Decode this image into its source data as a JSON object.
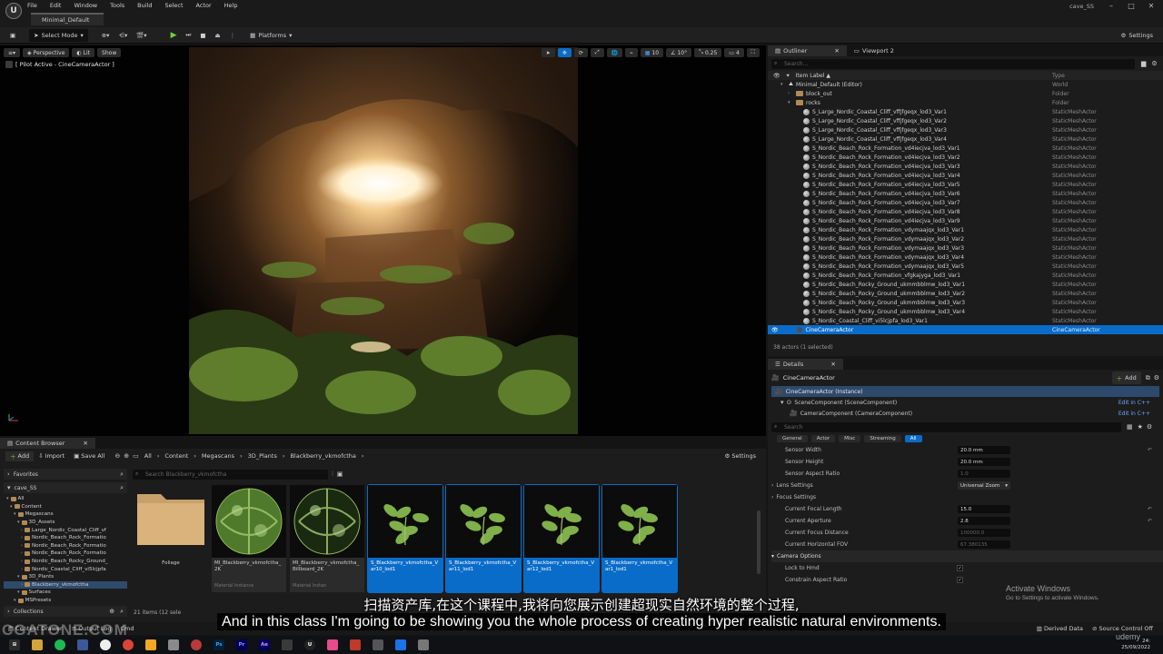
{
  "menu": [
    "File",
    "Edit",
    "Window",
    "Tools",
    "Build",
    "Select",
    "Actor",
    "Help"
  ],
  "doc_tab": "Minimal_Default",
  "window_title": "cave_SS",
  "toolbar": {
    "select_mode": "Select Mode",
    "platforms": "Platforms",
    "settings": "Settings"
  },
  "viewport": {
    "perspective": "Perspective",
    "lit": "Lit",
    "show": "Show",
    "pilot": "[ Pilot Active - CineCameraActor ]",
    "grid": "10",
    "angle": "10°",
    "scale": "0.25",
    "camera_speed": "4"
  },
  "outliner": {
    "tab": "Outliner",
    "tab2": "Viewport 2",
    "search_placeholder": "Search...",
    "col_label": "Item Label ▲",
    "col_type": "Type",
    "rows": [
      {
        "label": "Minimal_Default (Editor)",
        "type": "World",
        "indent": 1,
        "icon": "world"
      },
      {
        "label": "block_out",
        "type": "Folder",
        "indent": 2,
        "icon": "folder"
      },
      {
        "label": "rocks",
        "type": "Folder",
        "indent": 2,
        "icon": "folder"
      },
      {
        "label": "S_Large_Nordic_Coastal_Cliff_vffjfgeqx_lod3_Var1",
        "type": "StaticMeshActor",
        "indent": 3,
        "icon": "mesh"
      },
      {
        "label": "S_Large_Nordic_Coastal_Cliff_vffjfgeqx_lod3_Var2",
        "type": "StaticMeshActor",
        "indent": 3,
        "icon": "mesh"
      },
      {
        "label": "S_Large_Nordic_Coastal_Cliff_vffjfgeqx_lod3_Var3",
        "type": "StaticMeshActor",
        "indent": 3,
        "icon": "mesh"
      },
      {
        "label": "S_Large_Nordic_Coastal_Cliff_vffjfgeqx_lod3_Var4",
        "type": "StaticMeshActor",
        "indent": 3,
        "icon": "mesh"
      },
      {
        "label": "S_Nordic_Beach_Rock_Formation_vd4iecjva_lod3_Var1",
        "type": "StaticMeshActor",
        "indent": 3,
        "icon": "mesh"
      },
      {
        "label": "S_Nordic_Beach_Rock_Formation_vd4iecjva_lod3_Var2",
        "type": "StaticMeshActor",
        "indent": 3,
        "icon": "mesh"
      },
      {
        "label": "S_Nordic_Beach_Rock_Formation_vd4iecjva_lod3_Var3",
        "type": "StaticMeshActor",
        "indent": 3,
        "icon": "mesh"
      },
      {
        "label": "S_Nordic_Beach_Rock_Formation_vd4iecjva_lod3_Var4",
        "type": "StaticMeshActor",
        "indent": 3,
        "icon": "mesh"
      },
      {
        "label": "S_Nordic_Beach_Rock_Formation_vd4iecjva_lod3_Var5",
        "type": "StaticMeshActor",
        "indent": 3,
        "icon": "mesh"
      },
      {
        "label": "S_Nordic_Beach_Rock_Formation_vd4iecjva_lod3_Var6",
        "type": "StaticMeshActor",
        "indent": 3,
        "icon": "mesh"
      },
      {
        "label": "S_Nordic_Beach_Rock_Formation_vd4iecjva_lod3_Var7",
        "type": "StaticMeshActor",
        "indent": 3,
        "icon": "mesh"
      },
      {
        "label": "S_Nordic_Beach_Rock_Formation_vd4iecjva_lod3_Var8",
        "type": "StaticMeshActor",
        "indent": 3,
        "icon": "mesh"
      },
      {
        "label": "S_Nordic_Beach_Rock_Formation_vd4iecjva_lod3_Var9",
        "type": "StaticMeshActor",
        "indent": 3,
        "icon": "mesh"
      },
      {
        "label": "S_Nordic_Beach_Rock_Formation_vdymaajqx_lod3_Var1",
        "type": "StaticMeshActor",
        "indent": 3,
        "icon": "mesh"
      },
      {
        "label": "S_Nordic_Beach_Rock_Formation_vdymaajqx_lod3_Var2",
        "type": "StaticMeshActor",
        "indent": 3,
        "icon": "mesh"
      },
      {
        "label": "S_Nordic_Beach_Rock_Formation_vdymaajqx_lod3_Var3",
        "type": "StaticMeshActor",
        "indent": 3,
        "icon": "mesh"
      },
      {
        "label": "S_Nordic_Beach_Rock_Formation_vdymaajqx_lod3_Var4",
        "type": "StaticMeshActor",
        "indent": 3,
        "icon": "mesh"
      },
      {
        "label": "S_Nordic_Beach_Rock_Formation_vdymaajqx_lod3_Var5",
        "type": "StaticMeshActor",
        "indent": 3,
        "icon": "mesh"
      },
      {
        "label": "S_Nordic_Beach_Rock_Formation_vfgkajyga_lod3_Var1",
        "type": "StaticMeshActor",
        "indent": 3,
        "icon": "mesh"
      },
      {
        "label": "S_Nordic_Beach_Rocky_Ground_ukmmbblmw_lod3_Var1",
        "type": "StaticMeshActor",
        "indent": 3,
        "icon": "mesh"
      },
      {
        "label": "S_Nordic_Beach_Rocky_Ground_ukmmbblmw_lod3_Var2",
        "type": "StaticMeshActor",
        "indent": 3,
        "icon": "mesh"
      },
      {
        "label": "S_Nordic_Beach_Rocky_Ground_ukmmbblmw_lod3_Var3",
        "type": "StaticMeshActor",
        "indent": 3,
        "icon": "mesh"
      },
      {
        "label": "S_Nordic_Beach_Rocky_Ground_ukmmbblmw_lod3_Var4",
        "type": "StaticMeshActor",
        "indent": 3,
        "icon": "mesh"
      },
      {
        "label": "S_Nordic_Coastal_Cliff_vi5lcjpfa_lod3_Var1",
        "type": "StaticMeshActor",
        "indent": 3,
        "icon": "mesh"
      },
      {
        "label": "CineCameraActor",
        "type": "CineCameraActor",
        "indent": 2,
        "icon": "camera",
        "selected": true
      }
    ],
    "footer": "38 actors (1 selected)"
  },
  "details": {
    "tab": "Details",
    "actor_name": "CineCameraActor",
    "add_label": "Add",
    "instance": "CineCameraActor (Instance)",
    "scene_component": "SceneComponent (SceneComponent)",
    "camera_component": "CameraComponent (CameraComponent)",
    "edit_cpp": "Edit in C++",
    "search_placeholder": "Search",
    "filters": [
      "General",
      "Actor",
      "Misc",
      "Streaming",
      "All"
    ],
    "rows": [
      {
        "label": "Sensor Width",
        "value": "20.0 mm",
        "kind": "value"
      },
      {
        "label": "Sensor Height",
        "value": "20.0 mm",
        "kind": "value"
      },
      {
        "label": "Sensor Aspect Ratio",
        "value": "1.0",
        "kind": "dim"
      },
      {
        "label": "Lens Settings",
        "value": "Universal Zoom",
        "kind": "dropdown",
        "section": true
      },
      {
        "label": "Focus Settings",
        "value": "",
        "kind": "none",
        "section": true
      },
      {
        "label": "Current Focal Length",
        "value": "15.0",
        "kind": "value"
      },
      {
        "label": "Current Aperture",
        "value": "2.8",
        "kind": "value"
      },
      {
        "label": "Current Focus Distance",
        "value": "100000.0",
        "kind": "dim"
      },
      {
        "label": "Current Horizontal FOV",
        "value": "67.380135",
        "kind": "dim"
      },
      {
        "label": "Camera Options",
        "value": "",
        "kind": "header"
      },
      {
        "label": "Lock to Hmd",
        "value": "",
        "kind": "check"
      },
      {
        "label": "Constrain Aspect Ratio",
        "value": "",
        "kind": "check"
      }
    ]
  },
  "content_browser": {
    "tab": "Content Browser",
    "add_label": "Add",
    "import_label": "Import",
    "save_all_label": "Save All",
    "settings_label": "Settings",
    "breadcrumb": [
      "All",
      "Content",
      "Megascans",
      "3D_Plants",
      "Blackberry_vkmofctha"
    ],
    "favorites": "Favorites",
    "project": "cave_SS",
    "search_placeholder": "Search Blackberry_vkmofctha",
    "tree": [
      {
        "label": "All",
        "indent": 0
      },
      {
        "label": "Content",
        "indent": 1
      },
      {
        "label": "Megascans",
        "indent": 2
      },
      {
        "label": "3D_Assets",
        "indent": 3
      },
      {
        "label": "Large_Nordic_Coastal_Cliff_vf",
        "indent": 4
      },
      {
        "label": "Nordic_Beach_Rock_Formatio",
        "indent": 4
      },
      {
        "label": "Nordic_Beach_Rock_Formatio",
        "indent": 4
      },
      {
        "label": "Nordic_Beach_Rock_Formatio",
        "indent": 4
      },
      {
        "label": "Nordic_Beach_Rocky_Ground_",
        "indent": 4
      },
      {
        "label": "Nordic_Coastal_Cliff_vi5lcjpfa",
        "indent": 4
      },
      {
        "label": "3D_Plants",
        "indent": 3
      },
      {
        "label": "Blackberry_vkmofctha",
        "indent": 4,
        "selected": true
      },
      {
        "label": "Surfaces",
        "indent": 3
      },
      {
        "label": "MSPresets",
        "indent": 2
      },
      {
        "label": "StarterContent",
        "indent": 2
      }
    ],
    "collections": "Collections",
    "items_count": "21 items (12 sele",
    "tiles": [
      {
        "label": "Foliage",
        "sub": "",
        "kind": "folder"
      },
      {
        "label": "MI_Blackberry_vkmofctha_2K",
        "sub": "Material Instance",
        "kind": "mat"
      },
      {
        "label": "MI_Blackberry_vkmofctha_Billboard_2K",
        "sub": "Material Instan",
        "kind": "mat2"
      },
      {
        "label": "S_Blackberry_vkmofctha_Var10_lod1",
        "sub": "",
        "kind": "plant",
        "selected": true
      },
      {
        "label": "S_Blackberry_vkmofctha_Var11_lod1",
        "sub": "",
        "kind": "plant",
        "selected": true
      },
      {
        "label": "S_Blackberry_vkmofctha_Var12_lod1",
        "sub": "",
        "kind": "plant",
        "selected": true
      },
      {
        "label": "S_Blackberry_vkmofctha_Var1_lod1",
        "sub": "",
        "kind": "plant",
        "selected": true
      }
    ]
  },
  "status": {
    "content_drawer": "Content Drawer",
    "output_log": "Output Log",
    "cmd": "Cmd",
    "derived_data": "Derived Data",
    "source_control": "Source Control Off"
  },
  "taskbar": {
    "time": "24:",
    "date": "25/09/2022"
  },
  "subtitles": {
    "cn": "扫描资产库,在这个课程中,我将向您展示创建超现实自然环境的整个过程,",
    "en": "And in this class I'm going to be showing you the whole process of creating hyper realistic natural environments."
  },
  "watermark": "CGATONE.COM",
  "activate_windows": {
    "title": "Activate Windows",
    "sub": "Go to Settings to activate Windows."
  },
  "brand_udemy": "udemy"
}
